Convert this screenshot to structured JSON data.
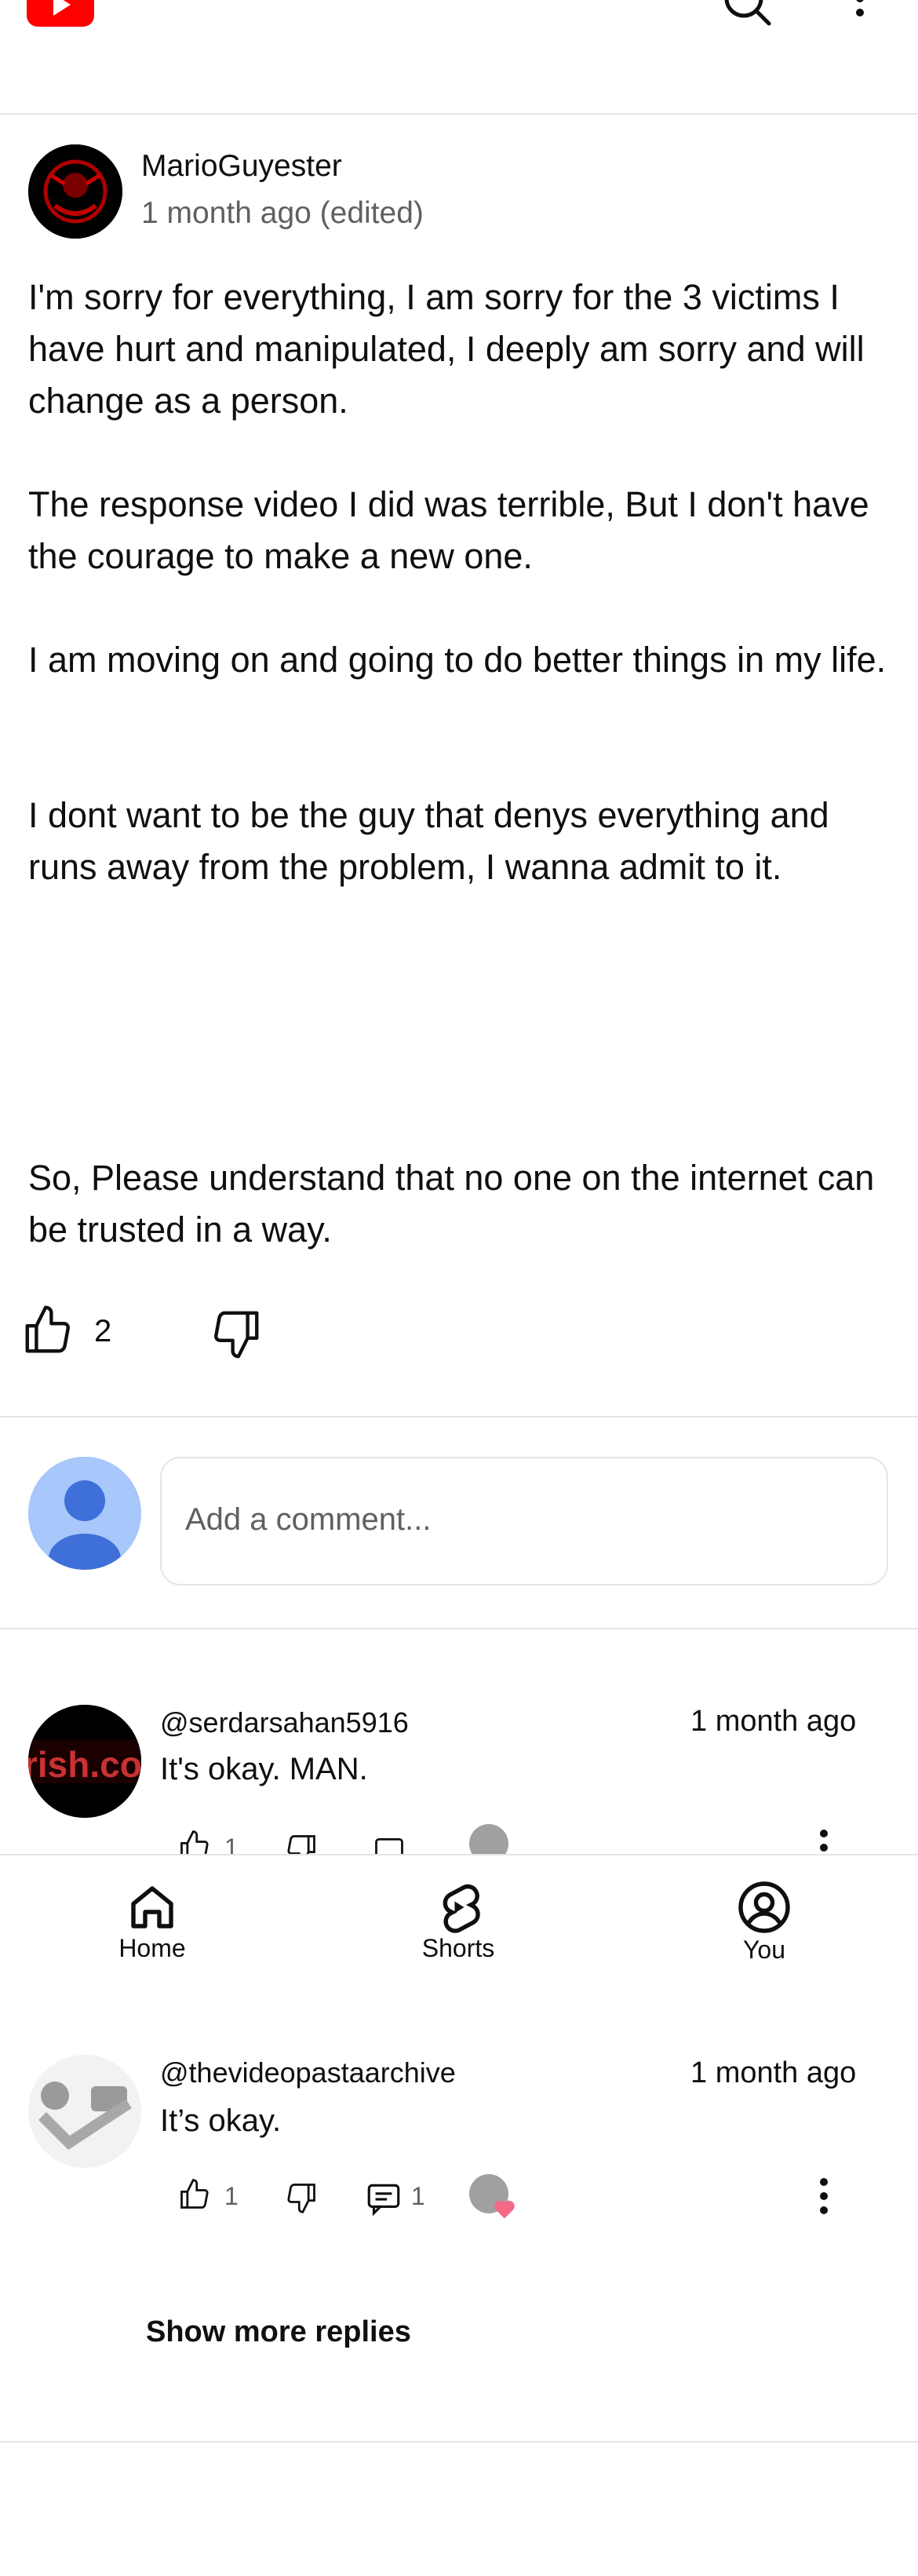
{
  "post": {
    "author": "MarioGuyester",
    "time": "1 month ago (edited)",
    "paragraphs": [
      "I'm sorry for everything, I am sorry for the 3 victims I have hurt and manipulated, I deeply am sorry and will change as a person.",
      "The response video I did was terrible, But I don't have the courage to make a new one.",
      "I am moving on and going to do better things in my life.",
      "I dont want to be the guy that denys everything and runs away from the problem, I wanna admit to it.",
      "So, Please understand that no one on the internet can be trusted in a way."
    ],
    "like_count": "2"
  },
  "add_comment": {
    "placeholder": "Add a comment..."
  },
  "comments": [
    {
      "handle": "@serdarsahan5916",
      "time": "1 month ago",
      "text": "It's okay. MAN.",
      "like_count": "1",
      "avatar_text": "rish.co"
    },
    {
      "handle": "@thevideopastaarchive",
      "time": "1 month ago",
      "text": "It’s okay.",
      "like_count": "1",
      "reply_count": "1"
    }
  ],
  "show_more_replies": "Show more replies",
  "nav": {
    "home": "Home",
    "shorts": "Shorts",
    "you": "You"
  },
  "colors": {
    "brand": "#ff0000",
    "text": "#0f0f0f",
    "secondary": "#606060",
    "divider": "#e5e5e5",
    "user_avatar": "#a8c7fa",
    "user_avatar_figure": "#3f6fd9"
  },
  "icons": [
    "youtube-logo-icon",
    "search-icon",
    "more-vert-icon",
    "thumb-up-icon",
    "thumb-down-icon",
    "reply-icon",
    "home-icon",
    "shorts-icon",
    "account-icon"
  ]
}
